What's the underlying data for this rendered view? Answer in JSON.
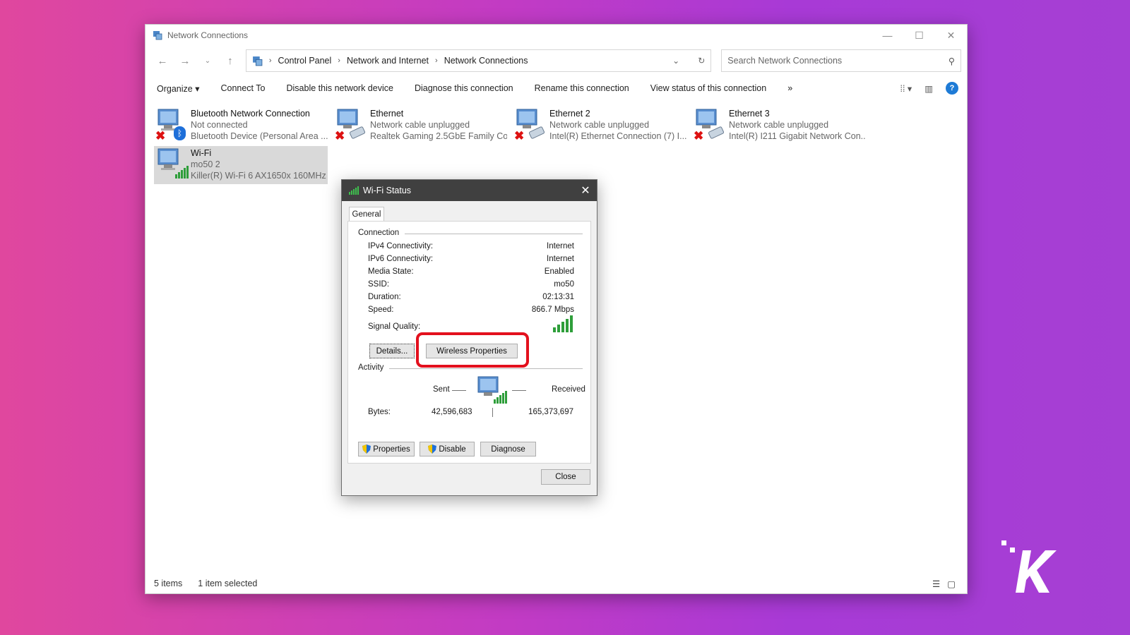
{
  "window": {
    "title": "Network Connections"
  },
  "address": {
    "crumbs": [
      "Control Panel",
      "Network and Internet",
      "Network Connections"
    ],
    "search_placeholder": "Search Network Connections"
  },
  "toolbar": {
    "commands": [
      "Organize ▾",
      "Connect To",
      "Disable this network device",
      "Diagnose this connection",
      "Rename this connection",
      "View status of this connection"
    ],
    "more": "»"
  },
  "connections": [
    {
      "name": "Bluetooth Network Connection",
      "status": "Not connected",
      "device": "Bluetooth Device (Personal Area ...",
      "type": "bluetooth",
      "disconnected": true
    },
    {
      "name": "Ethernet",
      "status": "Network cable unplugged",
      "device": "Realtek Gaming 2.5GbE Family Co...",
      "type": "ethernet",
      "disconnected": true
    },
    {
      "name": "Ethernet 2",
      "status": "Network cable unplugged",
      "device": "Intel(R) Ethernet Connection (7) I...",
      "type": "ethernet",
      "disconnected": true
    },
    {
      "name": "Ethernet 3",
      "status": "Network cable unplugged",
      "device": "Intel(R) I211 Gigabit Network Con...",
      "type": "ethernet",
      "disconnected": true
    },
    {
      "name": "Wi-Fi",
      "status": "mo50 2",
      "device": "Killer(R) Wi-Fi 6 AX1650x 160MHz ...",
      "type": "wifi",
      "disconnected": false,
      "selected": true
    }
  ],
  "statusbar": {
    "count": "5 items",
    "selection": "1 item selected"
  },
  "dialog": {
    "title": "Wi-Fi Status",
    "tab": "General",
    "connection_header": "Connection",
    "rows": [
      {
        "label": "IPv4 Connectivity:",
        "value": "Internet"
      },
      {
        "label": "IPv6 Connectivity:",
        "value": "Internet"
      },
      {
        "label": "Media State:",
        "value": "Enabled"
      },
      {
        "label": "SSID:",
        "value": "mo50"
      },
      {
        "label": "Duration:",
        "value": "02:13:31"
      },
      {
        "label": "Speed:",
        "value": "866.7 Mbps"
      }
    ],
    "signal_label": "Signal Quality:",
    "signal_bars": 5,
    "details_button": "Details...",
    "wireless_button": "Wireless Properties",
    "activity_header": "Activity",
    "sent_label": "Sent",
    "received_label": "Received",
    "bytes_label": "Bytes:",
    "bytes_sent": "42,596,683",
    "bytes_received": "165,373,697",
    "properties_button": "Properties",
    "disable_button": "Disable",
    "diagnose_button": "Diagnose",
    "close_button": "Close"
  },
  "colors": {
    "highlight": "#e3101d",
    "signal_green": "#2e9e3a"
  }
}
